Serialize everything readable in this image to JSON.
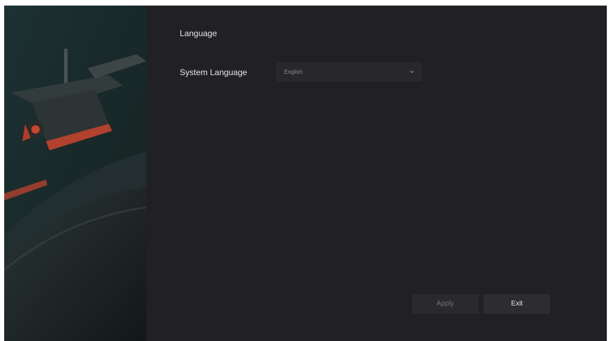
{
  "language_page": {
    "section_title": "Language",
    "system_language_label": "System Language",
    "system_language_value": "English",
    "chevron_icon": "chevron-down-icon"
  },
  "actions": {
    "apply_label": "Apply",
    "exit_label": "Exit"
  },
  "colors": {
    "background": "#212024",
    "select_background": "#28272b",
    "button_background": "#2d2c30",
    "accent_red": "#c8462f"
  }
}
